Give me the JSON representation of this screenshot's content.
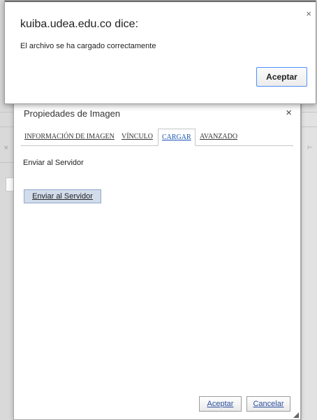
{
  "alert": {
    "title": "kuiba.udea.edu.co dice:",
    "message": "El archivo se ha cargado correctamente",
    "ok_label": "Aceptar",
    "close_glyph": "×"
  },
  "dialog": {
    "title": "Propiedades de Imagen",
    "close_glyph": "×",
    "tabs": [
      {
        "label": "INFORMACIÓN DE IMAGEN",
        "active": false
      },
      {
        "label": "VÍNCULO",
        "active": false
      },
      {
        "label": "CARGAR",
        "active": true
      },
      {
        "label": "AVANZADO",
        "active": false
      }
    ],
    "section_label": "Enviar al Servidor",
    "upload_button_label": "Enviar al Servidor",
    "ok_label": "Aceptar",
    "cancel_label": "Cancelar"
  },
  "background": {
    "marks": [
      "×",
      "⊢"
    ]
  },
  "colors": {
    "active_tab": "#1a55b3",
    "upload_button": "#d2dceb",
    "alert_focus": "#4d90fe"
  }
}
